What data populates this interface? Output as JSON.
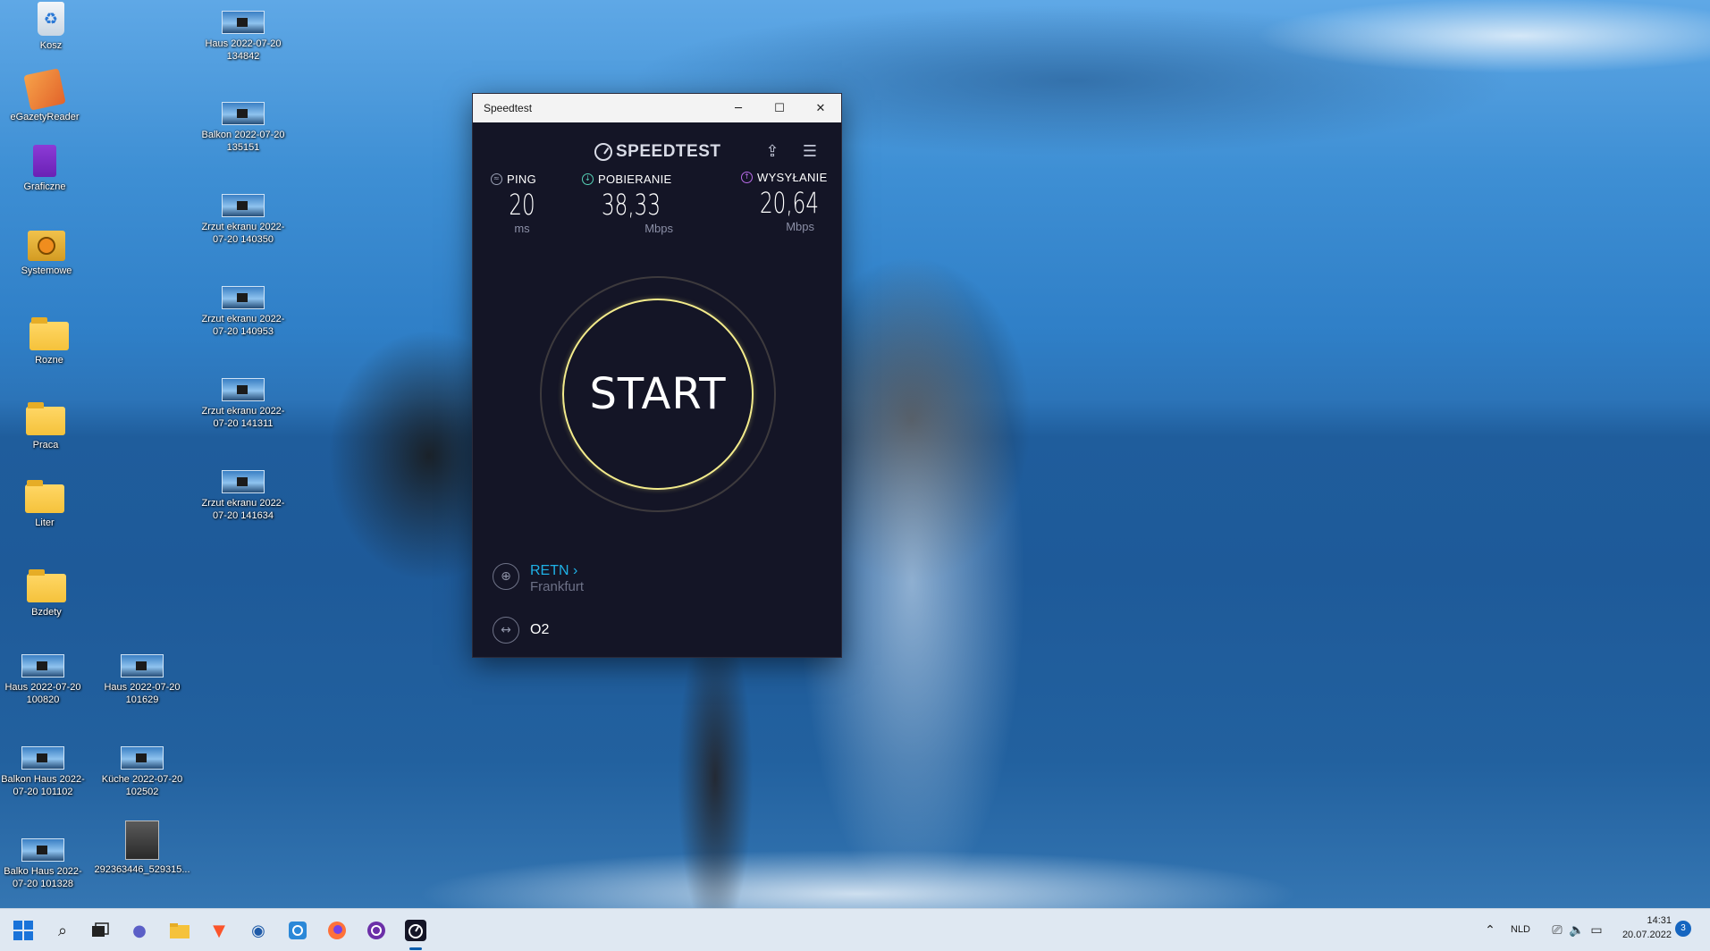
{
  "desktop": {
    "icons": {
      "recycle_bin": "Kosz",
      "egazety": "eGazetyReader",
      "graficzne": "Graficzne",
      "systemowe": "Systemowe",
      "rozne": "Rozne",
      "praca": "Praca",
      "liter": "Liter",
      "bzdety": "Bzdety",
      "haus_100820": "Haus 2022-07-20 100820",
      "haus_101629": "Haus 2022-07-20 101629",
      "balkon_haus_101102": "Balkon Haus 2022-07-20 101102",
      "kuche_102502": "Küche 2022-07-20 102502",
      "balko_haus_101328": "Balko Haus 2022-07-20 101328",
      "photo_file": "292363446_529315...",
      "haus_134842": "Haus 2022-07-20 134842",
      "balkon_135151": "Balkon 2022-07-20 135151",
      "zrzut_140350": "Zrzut ekranu 2022-07-20 140350",
      "zrzut_140953": "Zrzut ekranu 2022-07-20 140953",
      "zrzut_141311": "Zrzut ekranu 2022-07-20 141311",
      "zrzut_141634": "Zrzut ekranu 2022-07-20 141634"
    }
  },
  "window": {
    "title": "Speedtest",
    "minimize": "─",
    "maximize": "☐",
    "close": "✕"
  },
  "speedtest": {
    "logo": "SPEEDTEST",
    "share_icon": "share-icon",
    "settings_icon": "settings-icon",
    "ping": {
      "label": "PING",
      "value": "20",
      "unit": "ms",
      "color": "#9aa0b4"
    },
    "download": {
      "label": "POBIERANIE",
      "value": "38,33",
      "unit": "Mbps",
      "color": "#57d4b8"
    },
    "upload": {
      "label": "WYSYŁANIE",
      "value": "20,64",
      "unit": "Mbps",
      "color": "#b86be8"
    },
    "start_label": "START",
    "server": {
      "name": "RETN",
      "chevron": "›",
      "location": "Frankfurt"
    },
    "isp": {
      "name": "O2"
    }
  },
  "taskbar": {
    "language": "NLD",
    "time": "14:31",
    "date": "20.07.2022",
    "notifications": "3"
  }
}
